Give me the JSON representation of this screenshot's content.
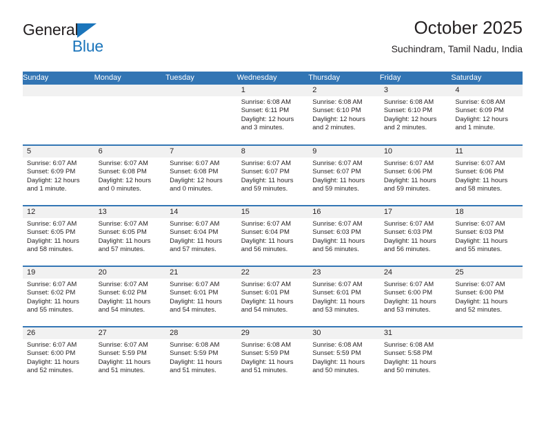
{
  "brand": {
    "name_part1": "General",
    "name_part2": "Blue",
    "accent_color": "#1b75bb",
    "triangle_icon": "brand-triangle-icon"
  },
  "header": {
    "title": "October 2025",
    "subtitle": "Suchindram, Tamil Nadu, India"
  },
  "colors": {
    "header_bar": "#3275b4",
    "day_number_band": "#f1f1f1",
    "text": "#231f20"
  },
  "weekdays": [
    "Sunday",
    "Monday",
    "Tuesday",
    "Wednesday",
    "Thursday",
    "Friday",
    "Saturday"
  ],
  "labels": {
    "sunrise_prefix": "Sunrise:",
    "sunset_prefix": "Sunset:",
    "daylight_prefix": "Daylight:"
  },
  "weeks": [
    [
      {
        "day": "",
        "empty": true
      },
      {
        "day": "",
        "empty": true
      },
      {
        "day": "",
        "empty": true
      },
      {
        "day": "1",
        "sunrise": "Sunrise: 6:08 AM",
        "sunset": "Sunset: 6:11 PM",
        "daylight_l1": "Daylight: 12 hours",
        "daylight_l2": "and 3 minutes."
      },
      {
        "day": "2",
        "sunrise": "Sunrise: 6:08 AM",
        "sunset": "Sunset: 6:10 PM",
        "daylight_l1": "Daylight: 12 hours",
        "daylight_l2": "and 2 minutes."
      },
      {
        "day": "3",
        "sunrise": "Sunrise: 6:08 AM",
        "sunset": "Sunset: 6:10 PM",
        "daylight_l1": "Daylight: 12 hours",
        "daylight_l2": "and 2 minutes."
      },
      {
        "day": "4",
        "sunrise": "Sunrise: 6:08 AM",
        "sunset": "Sunset: 6:09 PM",
        "daylight_l1": "Daylight: 12 hours",
        "daylight_l2": "and 1 minute."
      }
    ],
    [
      {
        "day": "5",
        "sunrise": "Sunrise: 6:07 AM",
        "sunset": "Sunset: 6:09 PM",
        "daylight_l1": "Daylight: 12 hours",
        "daylight_l2": "and 1 minute."
      },
      {
        "day": "6",
        "sunrise": "Sunrise: 6:07 AM",
        "sunset": "Sunset: 6:08 PM",
        "daylight_l1": "Daylight: 12 hours",
        "daylight_l2": "and 0 minutes."
      },
      {
        "day": "7",
        "sunrise": "Sunrise: 6:07 AM",
        "sunset": "Sunset: 6:08 PM",
        "daylight_l1": "Daylight: 12 hours",
        "daylight_l2": "and 0 minutes."
      },
      {
        "day": "8",
        "sunrise": "Sunrise: 6:07 AM",
        "sunset": "Sunset: 6:07 PM",
        "daylight_l1": "Daylight: 11 hours",
        "daylight_l2": "and 59 minutes."
      },
      {
        "day": "9",
        "sunrise": "Sunrise: 6:07 AM",
        "sunset": "Sunset: 6:07 PM",
        "daylight_l1": "Daylight: 11 hours",
        "daylight_l2": "and 59 minutes."
      },
      {
        "day": "10",
        "sunrise": "Sunrise: 6:07 AM",
        "sunset": "Sunset: 6:06 PM",
        "daylight_l1": "Daylight: 11 hours",
        "daylight_l2": "and 59 minutes."
      },
      {
        "day": "11",
        "sunrise": "Sunrise: 6:07 AM",
        "sunset": "Sunset: 6:06 PM",
        "daylight_l1": "Daylight: 11 hours",
        "daylight_l2": "and 58 minutes."
      }
    ],
    [
      {
        "day": "12",
        "sunrise": "Sunrise: 6:07 AM",
        "sunset": "Sunset: 6:05 PM",
        "daylight_l1": "Daylight: 11 hours",
        "daylight_l2": "and 58 minutes."
      },
      {
        "day": "13",
        "sunrise": "Sunrise: 6:07 AM",
        "sunset": "Sunset: 6:05 PM",
        "daylight_l1": "Daylight: 11 hours",
        "daylight_l2": "and 57 minutes."
      },
      {
        "day": "14",
        "sunrise": "Sunrise: 6:07 AM",
        "sunset": "Sunset: 6:04 PM",
        "daylight_l1": "Daylight: 11 hours",
        "daylight_l2": "and 57 minutes."
      },
      {
        "day": "15",
        "sunrise": "Sunrise: 6:07 AM",
        "sunset": "Sunset: 6:04 PM",
        "daylight_l1": "Daylight: 11 hours",
        "daylight_l2": "and 56 minutes."
      },
      {
        "day": "16",
        "sunrise": "Sunrise: 6:07 AM",
        "sunset": "Sunset: 6:03 PM",
        "daylight_l1": "Daylight: 11 hours",
        "daylight_l2": "and 56 minutes."
      },
      {
        "day": "17",
        "sunrise": "Sunrise: 6:07 AM",
        "sunset": "Sunset: 6:03 PM",
        "daylight_l1": "Daylight: 11 hours",
        "daylight_l2": "and 56 minutes."
      },
      {
        "day": "18",
        "sunrise": "Sunrise: 6:07 AM",
        "sunset": "Sunset: 6:03 PM",
        "daylight_l1": "Daylight: 11 hours",
        "daylight_l2": "and 55 minutes."
      }
    ],
    [
      {
        "day": "19",
        "sunrise": "Sunrise: 6:07 AM",
        "sunset": "Sunset: 6:02 PM",
        "daylight_l1": "Daylight: 11 hours",
        "daylight_l2": "and 55 minutes."
      },
      {
        "day": "20",
        "sunrise": "Sunrise: 6:07 AM",
        "sunset": "Sunset: 6:02 PM",
        "daylight_l1": "Daylight: 11 hours",
        "daylight_l2": "and 54 minutes."
      },
      {
        "day": "21",
        "sunrise": "Sunrise: 6:07 AM",
        "sunset": "Sunset: 6:01 PM",
        "daylight_l1": "Daylight: 11 hours",
        "daylight_l2": "and 54 minutes."
      },
      {
        "day": "22",
        "sunrise": "Sunrise: 6:07 AM",
        "sunset": "Sunset: 6:01 PM",
        "daylight_l1": "Daylight: 11 hours",
        "daylight_l2": "and 54 minutes."
      },
      {
        "day": "23",
        "sunrise": "Sunrise: 6:07 AM",
        "sunset": "Sunset: 6:01 PM",
        "daylight_l1": "Daylight: 11 hours",
        "daylight_l2": "and 53 minutes."
      },
      {
        "day": "24",
        "sunrise": "Sunrise: 6:07 AM",
        "sunset": "Sunset: 6:00 PM",
        "daylight_l1": "Daylight: 11 hours",
        "daylight_l2": "and 53 minutes."
      },
      {
        "day": "25",
        "sunrise": "Sunrise: 6:07 AM",
        "sunset": "Sunset: 6:00 PM",
        "daylight_l1": "Daylight: 11 hours",
        "daylight_l2": "and 52 minutes."
      }
    ],
    [
      {
        "day": "26",
        "sunrise": "Sunrise: 6:07 AM",
        "sunset": "Sunset: 6:00 PM",
        "daylight_l1": "Daylight: 11 hours",
        "daylight_l2": "and 52 minutes."
      },
      {
        "day": "27",
        "sunrise": "Sunrise: 6:07 AM",
        "sunset": "Sunset: 5:59 PM",
        "daylight_l1": "Daylight: 11 hours",
        "daylight_l2": "and 51 minutes."
      },
      {
        "day": "28",
        "sunrise": "Sunrise: 6:08 AM",
        "sunset": "Sunset: 5:59 PM",
        "daylight_l1": "Daylight: 11 hours",
        "daylight_l2": "and 51 minutes."
      },
      {
        "day": "29",
        "sunrise": "Sunrise: 6:08 AM",
        "sunset": "Sunset: 5:59 PM",
        "daylight_l1": "Daylight: 11 hours",
        "daylight_l2": "and 51 minutes."
      },
      {
        "day": "30",
        "sunrise": "Sunrise: 6:08 AM",
        "sunset": "Sunset: 5:59 PM",
        "daylight_l1": "Daylight: 11 hours",
        "daylight_l2": "and 50 minutes."
      },
      {
        "day": "31",
        "sunrise": "Sunrise: 6:08 AM",
        "sunset": "Sunset: 5:58 PM",
        "daylight_l1": "Daylight: 11 hours",
        "daylight_l2": "and 50 minutes."
      },
      {
        "day": "",
        "empty": true
      }
    ]
  ]
}
